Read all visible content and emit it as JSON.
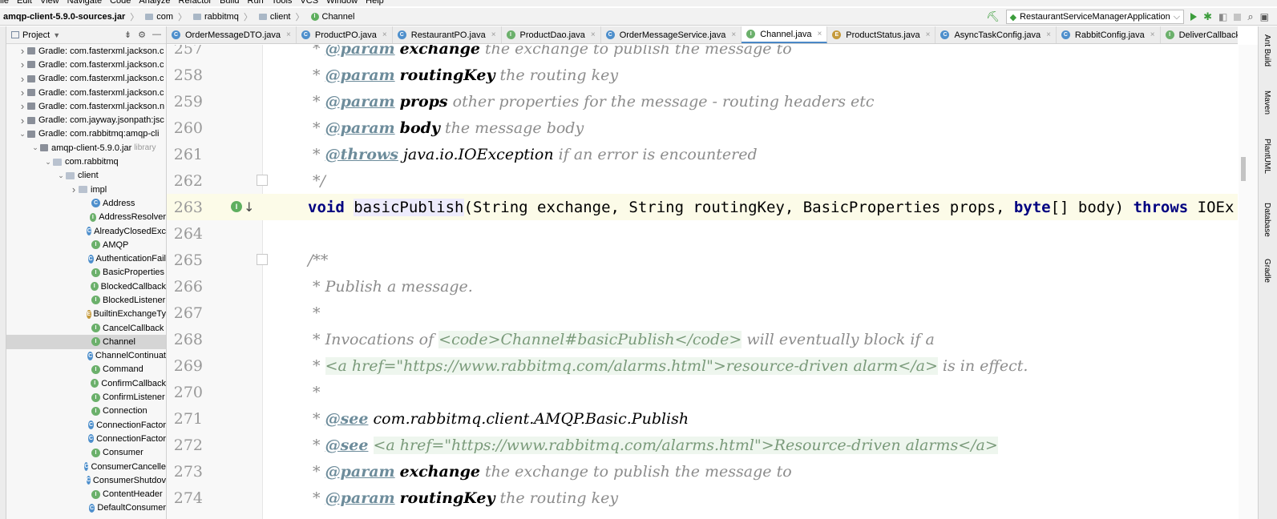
{
  "menu": [
    "ile",
    "Edit",
    "View",
    "Navigate",
    "Code",
    "Analyze",
    "Refactor",
    "Build",
    "Run",
    "Tools",
    "VCS",
    "Window",
    "Help"
  ],
  "breadcrumb": {
    "jar": "amqp-client-5.9.0-sources.jar",
    "items": [
      "com",
      "rabbitmq",
      "client"
    ],
    "current": "Channel"
  },
  "run_config": "RestaurantServiceManagerApplication",
  "project_panel": {
    "title": "Project",
    "rows": [
      {
        "indent": 0,
        "arrow": ">",
        "kind": "lib",
        "label": "Gradle: com.fasterxml.jackson.c"
      },
      {
        "indent": 0,
        "arrow": ">",
        "kind": "lib",
        "label": "Gradle: com.fasterxml.jackson.c"
      },
      {
        "indent": 0,
        "arrow": ">",
        "kind": "lib",
        "label": "Gradle: com.fasterxml.jackson.c"
      },
      {
        "indent": 0,
        "arrow": ">",
        "kind": "lib",
        "label": "Gradle: com.fasterxml.jackson.c"
      },
      {
        "indent": 0,
        "arrow": ">",
        "kind": "lib",
        "label": "Gradle: com.fasterxml.jackson.n"
      },
      {
        "indent": 0,
        "arrow": ">",
        "kind": "lib",
        "label": "Gradle: com.jayway.jsonpath:jsc"
      },
      {
        "indent": 0,
        "arrow": "v",
        "kind": "lib",
        "label": "Gradle: com.rabbitmq:amqp-cli"
      },
      {
        "indent": 1,
        "arrow": "v",
        "kind": "lib",
        "label": "amqp-client-5.9.0.jar",
        "tag": "library"
      },
      {
        "indent": 2,
        "arrow": "v",
        "kind": "pkg",
        "label": "com.rabbitmq"
      },
      {
        "indent": 3,
        "arrow": "v",
        "kind": "pkg",
        "label": "client"
      },
      {
        "indent": 4,
        "arrow": ">",
        "kind": "pkg",
        "label": "impl"
      },
      {
        "indent": 5,
        "arrow": "",
        "kind": "class",
        "label": "Address"
      },
      {
        "indent": 5,
        "arrow": "",
        "kind": "iface",
        "label": "AddressResolver"
      },
      {
        "indent": 5,
        "arrow": "",
        "kind": "class",
        "label": "AlreadyClosedExc"
      },
      {
        "indent": 5,
        "arrow": "",
        "kind": "iface",
        "label": "AMQP"
      },
      {
        "indent": 5,
        "arrow": "",
        "kind": "class",
        "label": "AuthenticationFail"
      },
      {
        "indent": 5,
        "arrow": "",
        "kind": "iface",
        "label": "BasicProperties"
      },
      {
        "indent": 5,
        "arrow": "",
        "kind": "iface",
        "label": "BlockedCallback"
      },
      {
        "indent": 5,
        "arrow": "",
        "kind": "iface",
        "label": "BlockedListener"
      },
      {
        "indent": 5,
        "arrow": "",
        "kind": "enum",
        "label": "BuiltinExchangeTy"
      },
      {
        "indent": 5,
        "arrow": "",
        "kind": "iface",
        "label": "CancelCallback"
      },
      {
        "indent": 5,
        "arrow": "",
        "kind": "iface",
        "label": "Channel",
        "selected": true
      },
      {
        "indent": 5,
        "arrow": "",
        "kind": "class",
        "label": "ChannelContinuat"
      },
      {
        "indent": 5,
        "arrow": "",
        "kind": "iface",
        "label": "Command"
      },
      {
        "indent": 5,
        "arrow": "",
        "kind": "iface",
        "label": "ConfirmCallback"
      },
      {
        "indent": 5,
        "arrow": "",
        "kind": "iface",
        "label": "ConfirmListener"
      },
      {
        "indent": 5,
        "arrow": "",
        "kind": "iface",
        "label": "Connection"
      },
      {
        "indent": 5,
        "arrow": "",
        "kind": "class",
        "label": "ConnectionFactor"
      },
      {
        "indent": 5,
        "arrow": "",
        "kind": "class",
        "label": "ConnectionFactor"
      },
      {
        "indent": 5,
        "arrow": "",
        "kind": "iface",
        "label": "Consumer"
      },
      {
        "indent": 5,
        "arrow": "",
        "kind": "class",
        "label": "ConsumerCancelle"
      },
      {
        "indent": 5,
        "arrow": "",
        "kind": "class",
        "label": "ConsumerShutdov"
      },
      {
        "indent": 5,
        "arrow": "",
        "kind": "iface",
        "label": "ContentHeader"
      },
      {
        "indent": 5,
        "arrow": "",
        "kind": "class",
        "label": "DefaultConsumer"
      }
    ]
  },
  "tabs": [
    {
      "label": "OrderMessageDTO.java",
      "kind": "class"
    },
    {
      "label": "ProductPO.java",
      "kind": "class"
    },
    {
      "label": "RestaurantPO.java",
      "kind": "class"
    },
    {
      "label": "ProductDao.java",
      "kind": "iface"
    },
    {
      "label": "OrderMessageService.java",
      "kind": "class"
    },
    {
      "label": "Channel.java",
      "kind": "iface",
      "active": true
    },
    {
      "label": "ProductStatus.java",
      "kind": "enum"
    },
    {
      "label": "AsyncTaskConfig.java",
      "kind": "class"
    },
    {
      "label": "RabbitConfig.java",
      "kind": "class"
    },
    {
      "label": "DeliverCallback.java",
      "kind": "iface"
    }
  ],
  "code_lines": [
    {
      "n": "257",
      "text": " * @param exchange the exchange to publish the message to"
    },
    {
      "n": "258",
      "text": " * @param routingKey the routing key"
    },
    {
      "n": "259",
      "text": " * @param props other properties for the message - routing headers etc"
    },
    {
      "n": "260",
      "text": " * @param body the message body"
    },
    {
      "n": "261",
      "text": " * @throws java.io.IOException if an error is encountered"
    },
    {
      "n": "262",
      "text": " */"
    },
    {
      "n": "263",
      "text": "void basicPublish(String exchange, String routingKey, BasicProperties props, byte[] body) throws IOEx"
    },
    {
      "n": "264",
      "text": ""
    },
    {
      "n": "265",
      "text": "/**"
    },
    {
      "n": "266",
      "text": " * Publish a message."
    },
    {
      "n": "267",
      "text": " *"
    },
    {
      "n": "268",
      "text": " * Invocations of <code>Channel#basicPublish</code> will eventually block if a"
    },
    {
      "n": "269",
      "text": " * <a href=\"https://www.rabbitmq.com/alarms.html\">resource-driven alarm</a> is in effect."
    },
    {
      "n": "270",
      "text": " *"
    },
    {
      "n": "271",
      "text": " * @see com.rabbitmq.client.AMQP.Basic.Publish"
    },
    {
      "n": "272",
      "text": " * @see <a href=\"https://www.rabbitmq.com/alarms.html\">Resource-driven alarms</a>"
    },
    {
      "n": "273",
      "text": " * @param exchange the exchange to publish the message to"
    },
    {
      "n": "274",
      "text": " * @param routingKey the routing key"
    }
  ],
  "right_tools": [
    "Ant Build",
    "Maven",
    "PlantUML",
    "Database",
    "Gradle"
  ],
  "colors": {
    "keyword": "#000080",
    "comment": "#8c8c8c",
    "current_line": "#fcfbe8",
    "selection": "#d5d5d5",
    "accent": "#4a88c7"
  }
}
